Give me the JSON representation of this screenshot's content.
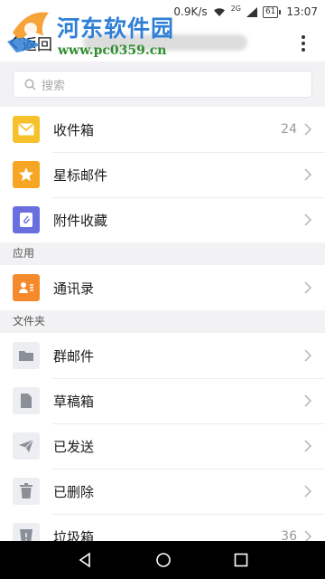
{
  "status_bar": {
    "speed": "0.9K/s",
    "network": "2G",
    "battery": "61",
    "time": "13:07"
  },
  "watermark": {
    "title": "河东软件园",
    "url": "www.pc0359.cn"
  },
  "header": {
    "back_label": "返回"
  },
  "search": {
    "placeholder": "搜索"
  },
  "mail_items": [
    {
      "label": "收件箱",
      "count": "24",
      "icon": "inbox-icon",
      "color": "#f6c12b"
    },
    {
      "label": "星标邮件",
      "count": "",
      "icon": "star-icon",
      "color": "#f6a623"
    },
    {
      "label": "附件收藏",
      "count": "",
      "icon": "attachment-icon",
      "color": "#6a6fe0"
    }
  ],
  "sections": {
    "apps": "应用",
    "folders": "文件夹"
  },
  "app_items": [
    {
      "label": "通讯录",
      "icon": "contacts-icon",
      "color": "#f48a2b"
    }
  ],
  "folder_items": [
    {
      "label": "群邮件",
      "count": "",
      "icon": "folder-icon"
    },
    {
      "label": "草稿箱",
      "count": "",
      "icon": "draft-icon"
    },
    {
      "label": "已发送",
      "count": "",
      "icon": "send-icon"
    },
    {
      "label": "已删除",
      "count": "",
      "icon": "trash-icon"
    },
    {
      "label": "垃圾箱",
      "count": "36",
      "icon": "spam-icon"
    }
  ]
}
